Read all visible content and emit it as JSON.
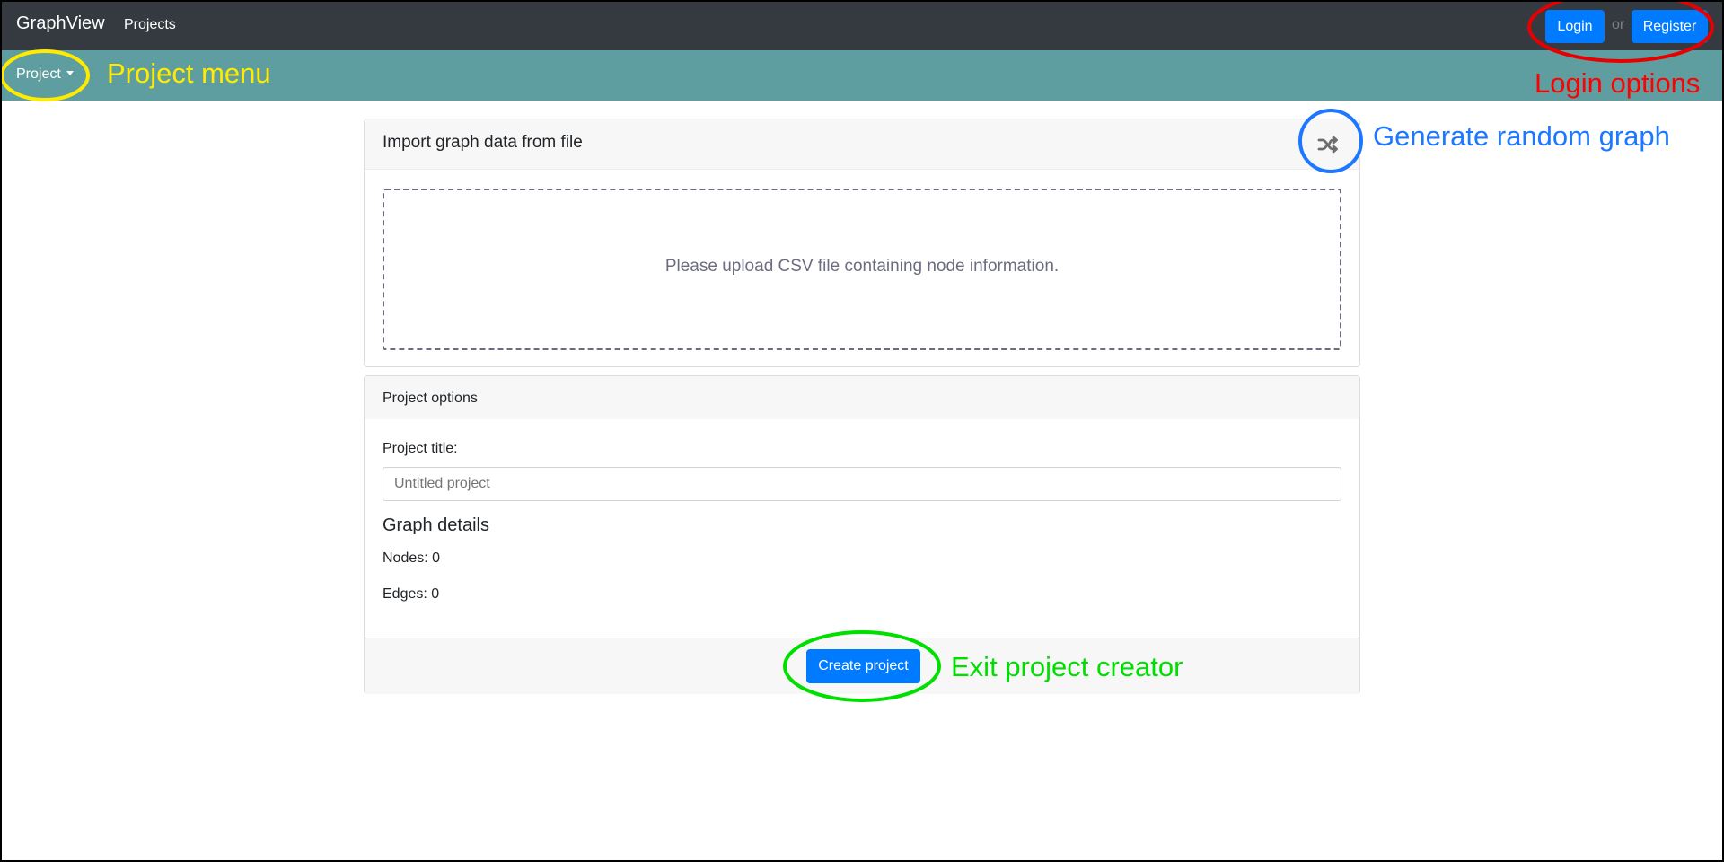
{
  "navbar": {
    "brand": "GraphView",
    "projects_link": "Projects",
    "login_label": "Login",
    "or_text": "or",
    "register_label": "Register"
  },
  "subnav": {
    "project_menu_label": "Project"
  },
  "import_card": {
    "title": "Import graph data from file",
    "random_icon": "shuffle-icon",
    "dropzone_text": "Please upload CSV file containing node information."
  },
  "options_card": {
    "title": "Project options",
    "project_title_label": "Project title:",
    "project_title_placeholder": "Untitled project",
    "project_title_value": "",
    "graph_details_heading": "Graph details",
    "nodes_text": "Nodes: 0",
    "edges_text": "Edges: 0",
    "create_label": "Create project"
  },
  "annotations": [
    {
      "id": "project-menu",
      "text": "Project menu",
      "color": "#ffeb00"
    },
    {
      "id": "login-options",
      "text": "Login options",
      "color": "#ff0000"
    },
    {
      "id": "generate-random-graph",
      "text": "Generate random graph",
      "color": "#1e78ff"
    },
    {
      "id": "exit-project-creator",
      "text": "Exit project creator",
      "color": "#00e000"
    }
  ],
  "colors": {
    "navbar_bg": "#343a40",
    "subnav_bg": "#5f9ea0",
    "primary": "#007bff"
  }
}
